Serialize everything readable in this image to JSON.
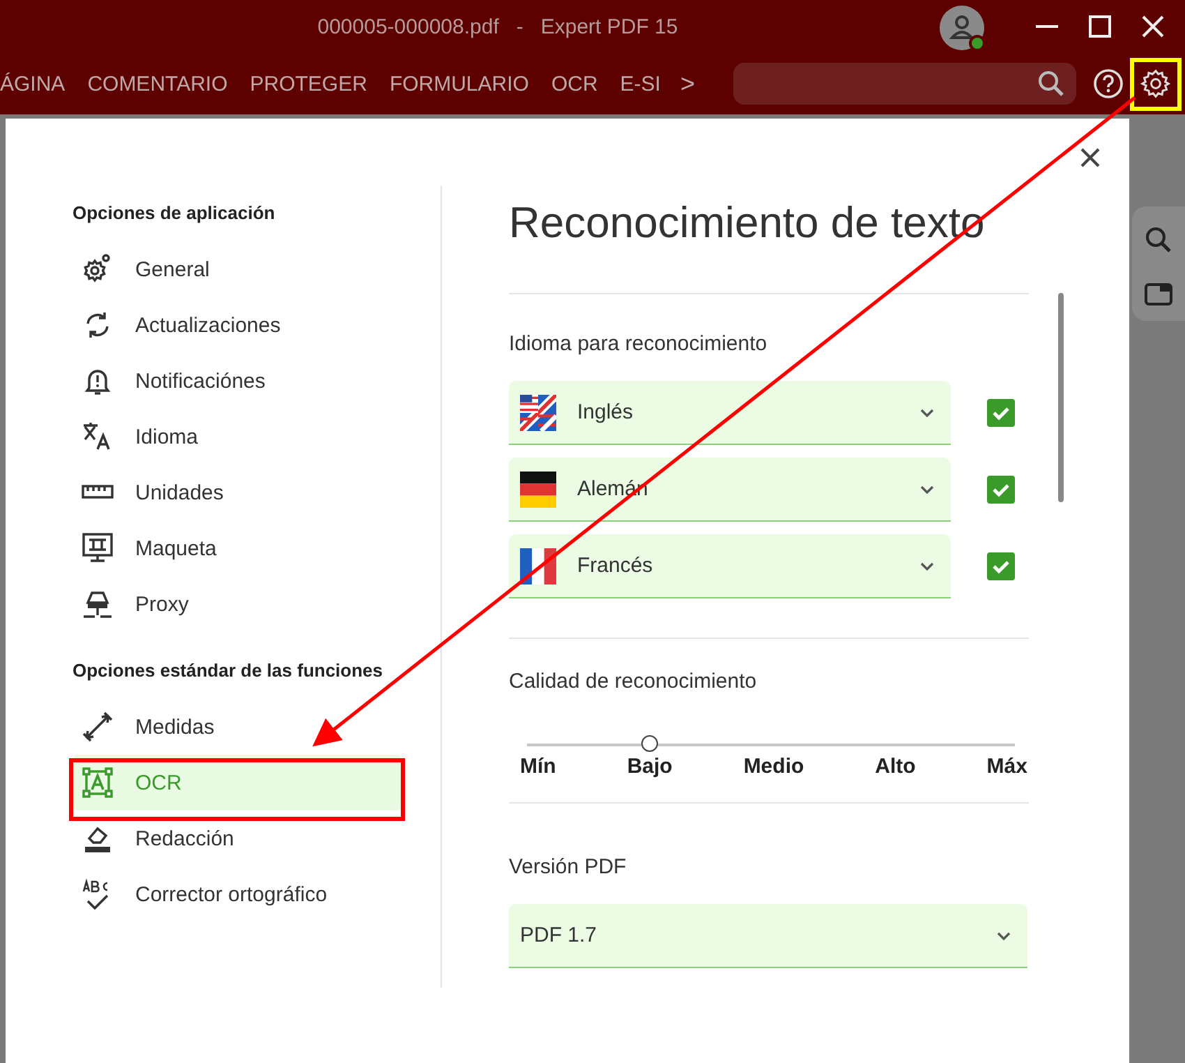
{
  "window": {
    "title": "000005-000008.pdf   -   Expert PDF 15"
  },
  "toolbar": {
    "tabs": [
      {
        "label": "ÁGINA"
      },
      {
        "label": "COMENTARIO"
      },
      {
        "label": "PROTEGER"
      },
      {
        "label": "FORMULARIO"
      },
      {
        "label": "OCR"
      },
      {
        "label": "E-SI"
      }
    ],
    "more": ">"
  },
  "dialog": {
    "title": "Reconocimiento de texto",
    "sidebar": [
      {
        "heading": "Opciones de aplicación",
        "items": [
          {
            "label": "General",
            "selected": false
          },
          {
            "label": "Actualizaciones",
            "selected": false
          },
          {
            "label": "Notificaciónes",
            "selected": false
          },
          {
            "label": "Idioma",
            "selected": false
          },
          {
            "label": "Unidades",
            "selected": false
          },
          {
            "label": "Maqueta",
            "selected": false
          },
          {
            "label": "Proxy",
            "selected": false
          }
        ]
      },
      {
        "heading": "Opciones estándar de las funciones",
        "items": [
          {
            "label": "Medidas",
            "selected": false
          },
          {
            "label": "OCR",
            "selected": true
          },
          {
            "label": "Redacción",
            "selected": false
          },
          {
            "label": "Corrector ortográfico",
            "selected": false
          }
        ]
      }
    ],
    "languages": {
      "label": "Idioma para reconocimiento",
      "items": [
        {
          "name": "Inglés",
          "checked": true
        },
        {
          "name": "Alemán",
          "checked": true
        },
        {
          "name": "Francés",
          "checked": true
        }
      ]
    },
    "quality": {
      "label": "Calidad de reconocimiento",
      "level": 0.25,
      "ticks": [
        "Mín",
        "Bajo",
        "Medio",
        "Alto",
        "Máx"
      ]
    },
    "pdf_version": {
      "label": "Versión PDF",
      "value": "PDF 1.7"
    }
  }
}
